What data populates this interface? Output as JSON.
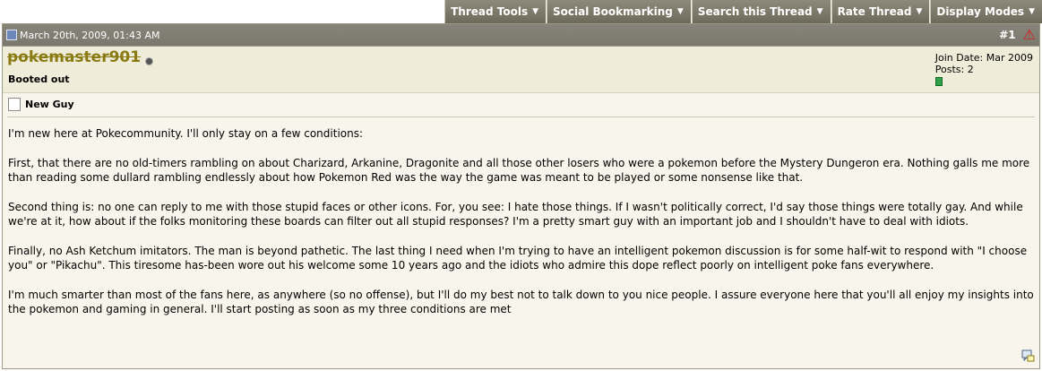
{
  "toolbar": {
    "items": [
      {
        "label": "Thread Tools"
      },
      {
        "label": "Social Bookmarking"
      },
      {
        "label": "Search this Thread"
      },
      {
        "label": "Rate Thread"
      },
      {
        "label": "Display Modes"
      }
    ]
  },
  "post": {
    "date": "March 20th, 2009, 01:43 AM",
    "number": "#1",
    "user": {
      "name": "pokemaster901",
      "title": "Booted out",
      "join_date": "Join Date: Mar 2009",
      "posts": "Posts: 2"
    },
    "title": "New Guy",
    "paragraphs": [
      "I'm new here at Pokecommunity. I'll only stay on a few conditions:",
      "First, that there are no old-timers rambling on about Charizard, Arkanine, Dragonite and all those other losers who were a pokemon before the Mystery Dungeron era. Nothing galls me more than reading some dullard rambling endlessly about how Pokemon Red was the way the game was meant to be played or some nonsense like that.",
      "Second thing is: no one can reply to me with those stupid faces or other icons. For, you see: I hate those things. If I wasn't politically correct, I'd say those things were totally gay. And while we're at it, how about if the folks monitoring these boards can filter out all stupid responses? I'm a pretty smart guy with an important job and I shouldn't have to deal with idiots.",
      "Finally, no Ash Ketchum imitators. The man is beyond pathetic. The last thing I need when I'm trying to have an intelligent pokemon discussion is for some half-wit to respond with \"I choose you\" or \"Pikachu\". This tiresome has-been wore out his welcome some 10 years ago and the idiots who admire this dope reflect poorly on intelligent poke fans everywhere.",
      "I'm much smarter than most of the fans here, as anywhere (so no offense), but I'll do my best not to talk down to you nice people. I assure everyone here that you'll all enjoy my insights into the pokemon and gaming in general. I'll start posting as soon as my three conditions are met"
    ]
  }
}
